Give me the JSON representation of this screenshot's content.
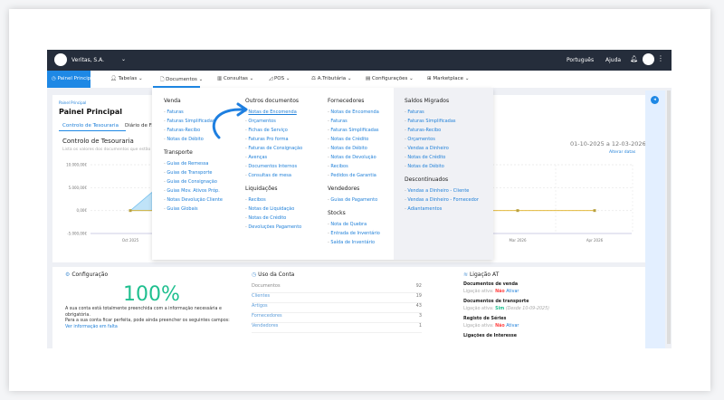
{
  "topbar": {
    "company": "Veritas, S.A.",
    "language": "Português",
    "help": "Ajuda"
  },
  "nav": {
    "home": "Painel Principal",
    "items": [
      "Tabelas",
      "Documentos",
      "Consultas",
      "POS",
      "A.Tributária",
      "Configurações",
      "Marketplace"
    ]
  },
  "page": {
    "breadcrumb": "Painel Principal",
    "title": "Painel Principal",
    "tabs": [
      "Controlo de Tesouraria",
      "Diário de Fa"
    ],
    "section_title": "Controlo de Tesouraria",
    "section_sub": "Lista os valores dos documentos que estão",
    "date_range": "01-10-2025 a 12-03-2026",
    "change_dates": "Alterar datas"
  },
  "chart_data": {
    "type": "line",
    "y_ticks": [
      "10.000,00€",
      "5.000,00€",
      "0,00€",
      "-5.000,00€"
    ],
    "x_ticks": [
      "Oct 2025",
      "Mar 2026",
      "Apr 2026"
    ],
    "ylim": [
      -5000,
      10000
    ],
    "grid": true,
    "series": [
      {
        "color": "#7cc4f0",
        "values": [
          0,
          4000
        ]
      },
      {
        "color": "#e0b020",
        "values": [
          0,
          0,
          0
        ]
      }
    ]
  },
  "menu": {
    "col1": [
      {
        "title": "Venda",
        "items": [
          "Faturas",
          "Faturas Simplificadas",
          "Faturas-Recibo",
          "Notas de Débito"
        ]
      },
      {
        "title": "Transporte",
        "items": [
          "Guias de Remessa",
          "Guias de Transporte",
          "Guias de Consignação",
          "Guias Mov. Ativos Próp.",
          "Notas Devolução Cliente",
          "Guias Globais"
        ]
      }
    ],
    "col2": [
      {
        "title": "Outros documentos",
        "items": [
          "Notas de Encomenda",
          "Orçamentos",
          "Fichas de Serviço",
          "Faturas Pro forma",
          "Faturas de Consignação",
          "Avenças",
          "Documentos Internos",
          "Consultas de mesa"
        ]
      },
      {
        "title": "Liquidações",
        "items": [
          "Recibos",
          "Notas de Liquidação",
          "Notas de Crédito",
          "Devoluções Pagamento"
        ]
      }
    ],
    "col3": [
      {
        "title": "Fornecedores",
        "items": [
          "Notas de Encomenda",
          "Faturas",
          "Faturas Simplificadas",
          "Notas de Crédito",
          "Notas de Débito",
          "Notas de Devolução",
          "Recibos",
          "Pedidos de Garantia"
        ]
      },
      {
        "title": "Vendedores",
        "items": [
          "Guias de Pagamento"
        ]
      },
      {
        "title": "Stocks",
        "items": [
          "Nota de Quebra",
          "Entrada de Inventário",
          "Saída de Inventário"
        ]
      }
    ],
    "col4": [
      {
        "title": "Saldos Migrados",
        "items": [
          "Faturas",
          "Faturas Simplificadas",
          "Faturas-Recibo",
          "Orçamentos",
          "Vendas a Dinheiro",
          "Notas de Crédito",
          "Notas de Débito"
        ]
      },
      {
        "title": "Descontinuados",
        "items": [
          "Vendas a Dinheiro - Cliente",
          "Vendas a Dinheiro - Fornecedor",
          "Adiantamentos"
        ]
      }
    ]
  },
  "config": {
    "title": "Configuração",
    "percent": "100%",
    "text1": "A sua conta está totalmente preenchida com a informação necessária e obrigatória.",
    "text2": "Para a sua conta ficar perfeita, pode ainda preencher os seguintes campos:",
    "link": "Ver informação em falta"
  },
  "usage": {
    "title": "Uso da Conta",
    "rows": [
      {
        "label": "Documentos",
        "value": "92"
      },
      {
        "label": "Clientes",
        "value": "19"
      },
      {
        "label": "Artigos",
        "value": "43"
      },
      {
        "label": "Fornecedores",
        "value": "3"
      },
      {
        "label": "Vendedores",
        "value": "1"
      }
    ]
  },
  "at": {
    "title": "Ligação AT",
    "label": "Ligação ativa:",
    "items": [
      {
        "title": "Documentos de venda",
        "status": "Não",
        "action": "Ativar"
      },
      {
        "title": "Documentos de transporte",
        "status": "Sim",
        "since": "(Desde 10-09-2025)"
      },
      {
        "title": "Registo de Séries",
        "status": "Não",
        "action": "Ativar"
      },
      {
        "title": "Ligações de Interesse"
      }
    ]
  }
}
